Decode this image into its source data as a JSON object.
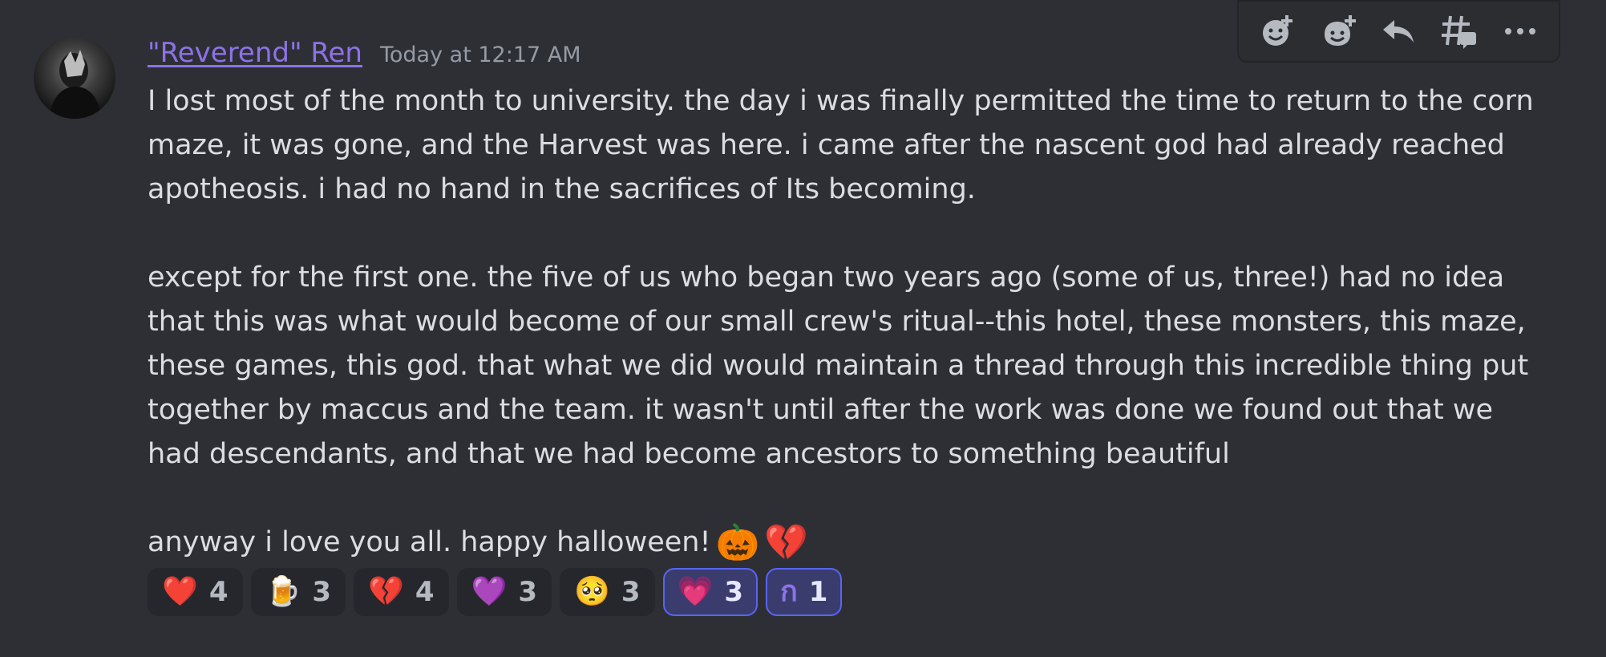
{
  "message": {
    "author": "\"Reverend\" Ren",
    "timestamp": "Today at 12:17 AM",
    "lines": [
      "I lost most of the month to university. the day i was finally permitted the time to return to the corn",
      "maze, it was gone, and the Harvest was here. i came after the nascent god had already reached",
      "apotheosis. i had no hand in the sacrifices of Its becoming.",
      "except for the first one. the five of us who began two years ago (some of us, three!) had no idea",
      "that this was what would become of our small crew's ritual--this hotel, these monsters, this maze,",
      "these games, this god. that what we did would maintain a thread through this incredible thing put",
      "together by maccus and the team. it wasn't until after the work was done we found out that we",
      "had descendants, and that we had become ancestors to something beautiful",
      "anyway i love you all. happy halloween!"
    ],
    "inline_emojis": [
      "🎃",
      "💔"
    ]
  },
  "reactions": [
    {
      "emoji": "❤️",
      "count": "4"
    },
    {
      "emoji": "🍺",
      "count": "3"
    },
    {
      "emoji": "💔",
      "count": "4"
    },
    {
      "emoji": "💜",
      "count": "3"
    },
    {
      "emoji": "🥺",
      "count": "3"
    },
    {
      "emoji": "💗",
      "count": "3"
    },
    {
      "emoji": "ก",
      "count": "1"
    }
  ],
  "toolbar": {
    "icons": [
      "add-super-reaction-icon",
      "add-reaction-icon",
      "reply-icon",
      "create-thread-icon",
      "more-icon"
    ]
  },
  "colors": {
    "background": "#2e2f35",
    "username": "#8d72e8",
    "text": "#dbdee1",
    "timestamp": "#949ba4",
    "active_reaction_border": "#5865f2"
  }
}
